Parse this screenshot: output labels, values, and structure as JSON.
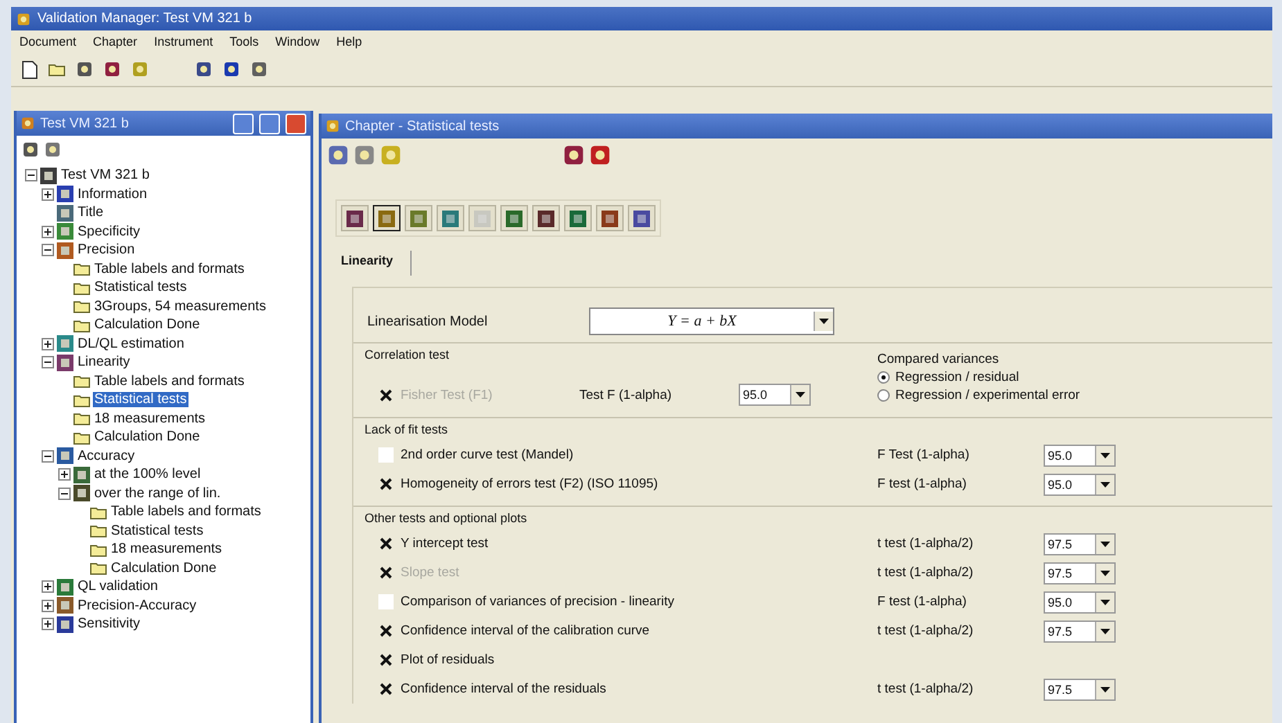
{
  "window": {
    "title": "Validation Manager: Test VM 321 b"
  },
  "menu": [
    {
      "label": "Document"
    },
    {
      "label": "Chapter"
    },
    {
      "label": "Instrument"
    },
    {
      "label": "Tools"
    },
    {
      "label": "Window"
    },
    {
      "label": "Help"
    }
  ],
  "tree_window": {
    "title": "Test VM 321 b",
    "root": {
      "label": "Test VM 321 b",
      "kind": "chapter",
      "color": "#3c3c3c",
      "selected": false,
      "expanded": true,
      "children": [
        {
          "label": "Information",
          "kind": "chapter",
          "color": "#2a3fb0",
          "selected": false,
          "expanded": false
        },
        {
          "label": "Title",
          "kind": "chapter",
          "color": "#4a6a7a",
          "selected": false
        },
        {
          "label": "Specificity",
          "kind": "chapter",
          "color": "#3a8a3a",
          "selected": false,
          "expanded": false
        },
        {
          "label": "Precision",
          "kind": "chapter",
          "color": "#b05a20",
          "selected": false,
          "expanded": true,
          "children": [
            {
              "label": "Table labels and formats",
              "kind": "folder",
              "selected": false
            },
            {
              "label": "Statistical tests",
              "kind": "folder",
              "selected": false
            },
            {
              "label": "3Groups, 54 measurements",
              "kind": "folder",
              "selected": false
            },
            {
              "label": "Calculation Done",
              "kind": "folder",
              "selected": false
            }
          ]
        },
        {
          "label": "DL/QL estimation",
          "kind": "chapter",
          "color": "#2a8a8a",
          "selected": false,
          "expanded": false
        },
        {
          "label": "Linearity",
          "kind": "chapter",
          "color": "#7a3a6a",
          "selected": false,
          "expanded": true,
          "children": [
            {
              "label": "Table labels and formats",
              "kind": "folder",
              "selected": false
            },
            {
              "label": "Statistical tests",
              "kind": "folder",
              "selected": true
            },
            {
              "label": "18 measurements",
              "kind": "folder",
              "selected": false
            },
            {
              "label": "Calculation Done",
              "kind": "folder",
              "selected": false
            }
          ]
        },
        {
          "label": "Accuracy",
          "kind": "chapter",
          "color": "#2a5aa0",
          "selected": false,
          "expanded": true,
          "children": [
            {
              "label": "at the 100% level",
              "kind": "chapter",
              "color": "#3a6a3a",
              "selected": false,
              "expanded": false
            },
            {
              "label": "over the range of lin.",
              "kind": "chapter",
              "color": "#4a4a2a",
              "selected": false,
              "expanded": true,
              "children": [
                {
                  "label": "Table labels and formats",
                  "kind": "folder",
                  "selected": false
                },
                {
                  "label": "Statistical tests",
                  "kind": "folder",
                  "selected": false
                },
                {
                  "label": "18 measurements",
                  "kind": "folder",
                  "selected": false
                },
                {
                  "label": "Calculation Done",
                  "kind": "folder",
                  "selected": false
                }
              ]
            }
          ]
        },
        {
          "label": "QL validation",
          "kind": "chapter",
          "color": "#2a7a3a",
          "selected": false,
          "expanded": false
        },
        {
          "label": "Precision-Accuracy",
          "kind": "chapter",
          "color": "#8a5a2a",
          "selected": false,
          "expanded": false
        },
        {
          "label": "Sensitivity",
          "kind": "chapter",
          "color": "#2a3a9a",
          "selected": false,
          "expanded": false
        }
      ]
    }
  },
  "chapter_window": {
    "title": "Chapter - Statistical tests",
    "chapter_buttons": [
      {
        "color": "#6a2a4a",
        "selected": false
      },
      {
        "color": "#8a6a10",
        "selected": true
      },
      {
        "color": "#6a7a2a",
        "selected": false
      },
      {
        "color": "#2a7a7a",
        "selected": false
      },
      {
        "color": "#c8c8c0",
        "selected": false
      },
      {
        "color": "#2a6a2a",
        "selected": false
      },
      {
        "color": "#5a2a2a",
        "selected": false
      },
      {
        "color": "#1a6a3a",
        "selected": false
      },
      {
        "color": "#8a3a1a",
        "selected": false
      },
      {
        "color": "#4a4aa0",
        "selected": false
      }
    ],
    "tabs": [
      {
        "label": "Linearity",
        "selected": true
      }
    ],
    "model": {
      "label": "Linearisation Model",
      "value": "Y = a + bX"
    },
    "correlation": {
      "title": "Correlation test",
      "row": {
        "label": "Fisher Test (F1)",
        "checked": true,
        "disabled": true,
        "test": "Test F (1-alpha)",
        "value": "95.0"
      },
      "compared_variances": {
        "title": "Compared variances",
        "options": [
          {
            "label": "Regression / residual",
            "selected": true
          },
          {
            "label": "Regression / experimental error",
            "selected": false
          }
        ]
      }
    },
    "sections": [
      {
        "title": "Lack of fit tests",
        "rows": [
          {
            "label": "2nd order curve test (Mandel)",
            "checked": false,
            "disabled": false,
            "test": "F Test (1-alpha)",
            "value": "95.0"
          },
          {
            "label": "Homogeneity of errors test (F2) (ISO 11095)",
            "checked": true,
            "disabled": false,
            "test": "F test (1-alpha)",
            "value": "95.0"
          }
        ]
      },
      {
        "title": "Other tests and optional plots",
        "rows": [
          {
            "label": "Y intercept test",
            "checked": true,
            "disabled": false,
            "test": "t test (1-alpha/2)",
            "value": "97.5"
          },
          {
            "label": "Slope test",
            "checked": true,
            "disabled": true,
            "test": "t test (1-alpha/2)",
            "value": "97.5"
          },
          {
            "label": "Comparison of variances of precision - linearity",
            "checked": false,
            "disabled": false,
            "test": "F test (1-alpha)",
            "value": "95.0"
          },
          {
            "label": "Confidence interval of the calibration curve",
            "checked": true,
            "disabled": false,
            "test": "t test (1-alpha/2)",
            "value": "97.5"
          },
          {
            "label": "Plot of residuals",
            "checked": true,
            "disabled": false
          },
          {
            "label": "Confidence interval of the residuals",
            "checked": true,
            "disabled": false,
            "test": "t test (1-alpha/2)",
            "value": "97.5"
          }
        ]
      }
    ]
  }
}
